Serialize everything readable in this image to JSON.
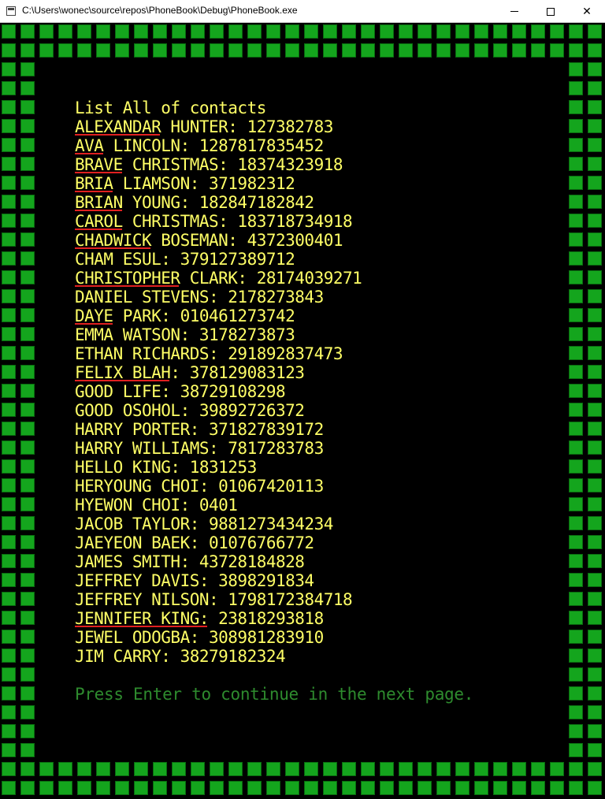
{
  "window": {
    "title": "C:\\Users\\wonec\\source\\repos\\PhoneBook\\Debug\\PhoneBook.exe",
    "close_glyph": "✕"
  },
  "console": {
    "heading": "List All of contacts",
    "contacts": [
      "ALEXANDAR HUNTER: 127382783",
      "AVA LINCOLN: 1287817835452",
      "BRAVE CHRISTMAS: 18374323918",
      "BRIA LIAMSON: 371982312",
      "BRIAN YOUNG: 182847182842",
      "CAROL CHRISTMAS: 183718734918",
      "CHADWICK BOSEMAN: 4372300401",
      "CHAM ESUL: 379127389712",
      "CHRISTOPHER CLARK: 28174039271",
      "DANIEL STEVENS: 2178273843",
      "DAYE PARK: 010461273742",
      "EMMA WATSON: 3178273873",
      "ETHAN RICHARDS: 291892837473",
      "FELIX BLAH: 378129083123",
      "GOOD LIFE: 38729108298",
      "GOOD OSOHOL: 39892726372",
      "HARRY PORTER: 371827839172",
      "HARRY WILLIAMS: 7817283783",
      "HELLO KING: 1831253",
      "HERYOUNG CHOI: 01067420113",
      "HYEWON CHOI: 0401",
      "JACOB TAYLOR: 9881273434234",
      "JAEYEON BAEK: 01076766772",
      "JAMES SMITH: 43728184828",
      "JEFFREY DAVIS: 3898291834",
      "JEFFREY NILSON: 1798172384718",
      "JENNIFER KING: 23818293818",
      "JEWEL ODOGBA: 308981283910",
      "JIM CARRY: 38279182324"
    ],
    "prompt": "Press Enter to continue in the next page.",
    "colors": {
      "text": "#ffff66",
      "prompt": "#2e8b2e",
      "border": "#14a51d",
      "underline": "#e02020",
      "background": "#000000"
    }
  }
}
